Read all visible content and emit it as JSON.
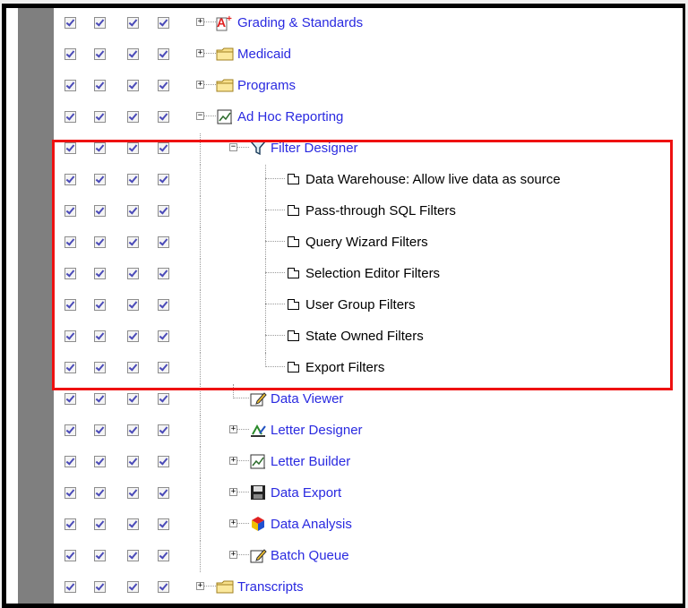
{
  "tree": {
    "rows": [
      {
        "label": "Grading & Standards",
        "icon": "grading-a-plus-icon",
        "level": 0,
        "expander": "+",
        "color": "link"
      },
      {
        "label": "Medicaid",
        "icon": "folder-icon",
        "level": 0,
        "expander": "+",
        "color": "link"
      },
      {
        "label": "Programs",
        "icon": "folder-icon",
        "level": 0,
        "expander": "+",
        "color": "link"
      },
      {
        "label": "Ad Hoc Reporting",
        "icon": "report-chart-icon",
        "level": 0,
        "expander": "-",
        "color": "link"
      },
      {
        "label": "Filter Designer",
        "icon": "funnel-filter-icon",
        "level": 1,
        "expander": "-",
        "color": "link"
      },
      {
        "label": "Data Warehouse: Allow live data as source",
        "icon": "leaf-tab-icon",
        "level": 2,
        "expander": "",
        "color": "black"
      },
      {
        "label": "Pass-through SQL Filters",
        "icon": "leaf-tab-icon",
        "level": 2,
        "expander": "",
        "color": "black"
      },
      {
        "label": "Query Wizard Filters",
        "icon": "leaf-tab-icon",
        "level": 2,
        "expander": "",
        "color": "black"
      },
      {
        "label": "Selection Editor Filters",
        "icon": "leaf-tab-icon",
        "level": 2,
        "expander": "",
        "color": "black"
      },
      {
        "label": "User Group Filters",
        "icon": "leaf-tab-icon",
        "level": 2,
        "expander": "",
        "color": "black"
      },
      {
        "label": "State Owned Filters",
        "icon": "leaf-tab-icon",
        "level": 2,
        "expander": "",
        "color": "black"
      },
      {
        "label": "Export Filters",
        "icon": "leaf-tab-icon",
        "level": 2,
        "expander": "",
        "color": "black"
      },
      {
        "label": "Data Viewer",
        "icon": "data-viewer-pencil-icon",
        "level": 1,
        "expander": "",
        "color": "link"
      },
      {
        "label": "Letter Designer",
        "icon": "letter-designer-icon",
        "level": 1,
        "expander": "+",
        "color": "link"
      },
      {
        "label": "Letter Builder",
        "icon": "report-chart-icon",
        "level": 1,
        "expander": "+",
        "color": "link"
      },
      {
        "label": "Data Export",
        "icon": "floppy-disk-icon",
        "level": 1,
        "expander": "+",
        "color": "link"
      },
      {
        "label": "Data Analysis",
        "icon": "cube-icon",
        "level": 1,
        "expander": "+",
        "color": "link"
      },
      {
        "label": "Batch Queue",
        "icon": "batch-pencil-icon",
        "level": 1,
        "expander": "+",
        "color": "link"
      },
      {
        "label": "Transcripts",
        "icon": "folder-icon",
        "level": 0,
        "expander": "+",
        "color": "link"
      }
    ],
    "checkbox_columns": 4,
    "all_checked": true
  },
  "colors": {
    "link": "#2a2ae0",
    "highlight_border": "#ee1111",
    "gutter": "#7f7f7f"
  }
}
